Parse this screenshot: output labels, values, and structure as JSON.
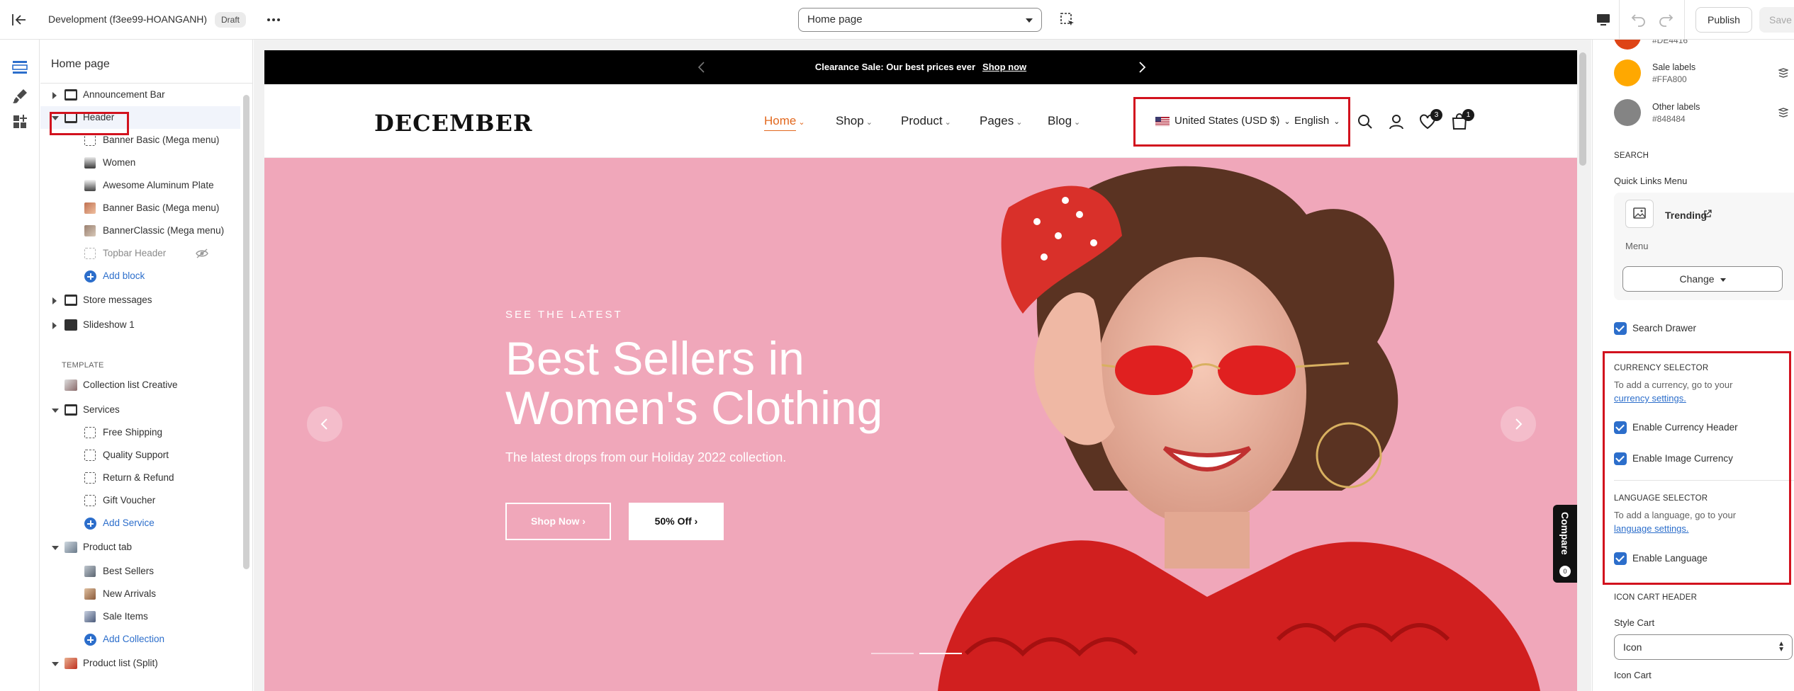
{
  "topbar": {
    "store_name": "Development (f3ee99-HOANGANH)",
    "status_badge": "Draft",
    "page_selector": "Home page",
    "publish_label": "Publish",
    "save_label": "Save"
  },
  "sidebar": {
    "title": "Home page",
    "sections": [
      {
        "label": "Announcement Bar"
      },
      {
        "label": "Header"
      },
      {
        "label": "Banner Basic (Mega menu)"
      },
      {
        "label": "Women"
      },
      {
        "label": "Awesome Aluminum Plate"
      },
      {
        "label": "Banner Basic (Mega menu)"
      },
      {
        "label": "BannerClassic (Mega menu)"
      },
      {
        "label": "Topbar Header"
      },
      {
        "label": "Add block"
      },
      {
        "label": "Store messages"
      },
      {
        "label": "Slideshow 1"
      },
      {
        "label": "TEMPLATE"
      },
      {
        "label": "Collection list Creative"
      },
      {
        "label": "Services"
      },
      {
        "label": "Free Shipping"
      },
      {
        "label": "Quality Support"
      },
      {
        "label": "Return & Refund"
      },
      {
        "label": "Gift Voucher"
      },
      {
        "label": "Add Service"
      },
      {
        "label": "Product tab"
      },
      {
        "label": "Best Sellers"
      },
      {
        "label": "New Arrivals"
      },
      {
        "label": "Sale Items"
      },
      {
        "label": "Add Collection"
      },
      {
        "label": "Product list (Split)"
      }
    ]
  },
  "preview": {
    "announcement": {
      "text": "Clearance Sale: Our best prices ever",
      "link": "Shop now"
    },
    "logo": "DECEMBER",
    "menu": [
      "Home",
      "Shop",
      "Product",
      "Pages",
      "Blog"
    ],
    "currency": "United States (USD $)",
    "language": "English",
    "wishlist_count": "3",
    "cart_count": "1",
    "hero": {
      "eyebrow": "SEE THE LATEST",
      "headline_line1": "Best Sellers in",
      "headline_line2": "Women's Clothing",
      "subtext": "The latest drops from our Holiday 2022 collection.",
      "btn_primary": "Shop Now",
      "btn_secondary": "50% Off"
    },
    "compare_label": "Compare",
    "compare_count": "0",
    "colors": {
      "hero_bg": "#f0a7ba",
      "accent": "#e2681e",
      "highlight_box": "#d2121e"
    }
  },
  "settings": {
    "partial_hex": "#DE4416",
    "swatches": [
      {
        "name": "Sale labels",
        "hex": "#FFA800"
      },
      {
        "name": "Other labels",
        "hex": "#848484"
      }
    ],
    "search_heading": "SEARCH",
    "quick_links_label": "Quick Links Menu",
    "menu_card_title": "Trending",
    "menu_card_sub": "Menu",
    "change_button": "Change",
    "search_drawer": "Search Drawer",
    "currency_heading": "CURRENCY SELECTOR",
    "currency_help": "To add a currency, go to your",
    "currency_link": "currency settings.",
    "enable_currency_header": "Enable Currency Header",
    "enable_image_currency": "Enable Image Currency",
    "language_heading": "LANGUAGE SELECTOR",
    "language_help": "To add a language, go to your",
    "language_link": "language settings.",
    "enable_language": "Enable Language",
    "icon_cart_heading": "ICON CART HEADER",
    "style_cart_label": "Style Cart",
    "style_cart_value": "Icon",
    "icon_cart_label": "Icon Cart"
  }
}
